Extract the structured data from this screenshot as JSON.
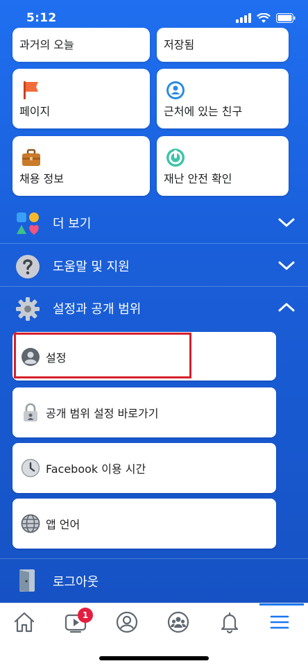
{
  "status_bar": {
    "time": "5:12"
  },
  "shortcuts": {
    "memories_label": "과거의 오늘",
    "saved_label": "저장됨",
    "pages_label": "페이지",
    "nearby_friends_label": "근처에 있는 친구",
    "jobs_label": "채용 정보",
    "crisis_response_label": "재난 안전 확인"
  },
  "sections": {
    "see_more_label": "더 보기",
    "help_label": "도움말 및 지원",
    "settings_privacy_label": "설정과 공개 범위",
    "logout_label": "로그아웃"
  },
  "settings_menu": {
    "settings_label": "설정",
    "privacy_shortcuts_label": "공개 범위 설정 바로가기",
    "time_on_facebook_label": "Facebook 이용 시간",
    "app_language_label": "앱 언어"
  },
  "tab_bar": {
    "video_badge": "1",
    "active_tab": "menu"
  },
  "colors": {
    "background": "#1a5fda",
    "highlight_border": "#d5202a",
    "accent": "#1877f2",
    "badge": "#e41e3f"
  }
}
